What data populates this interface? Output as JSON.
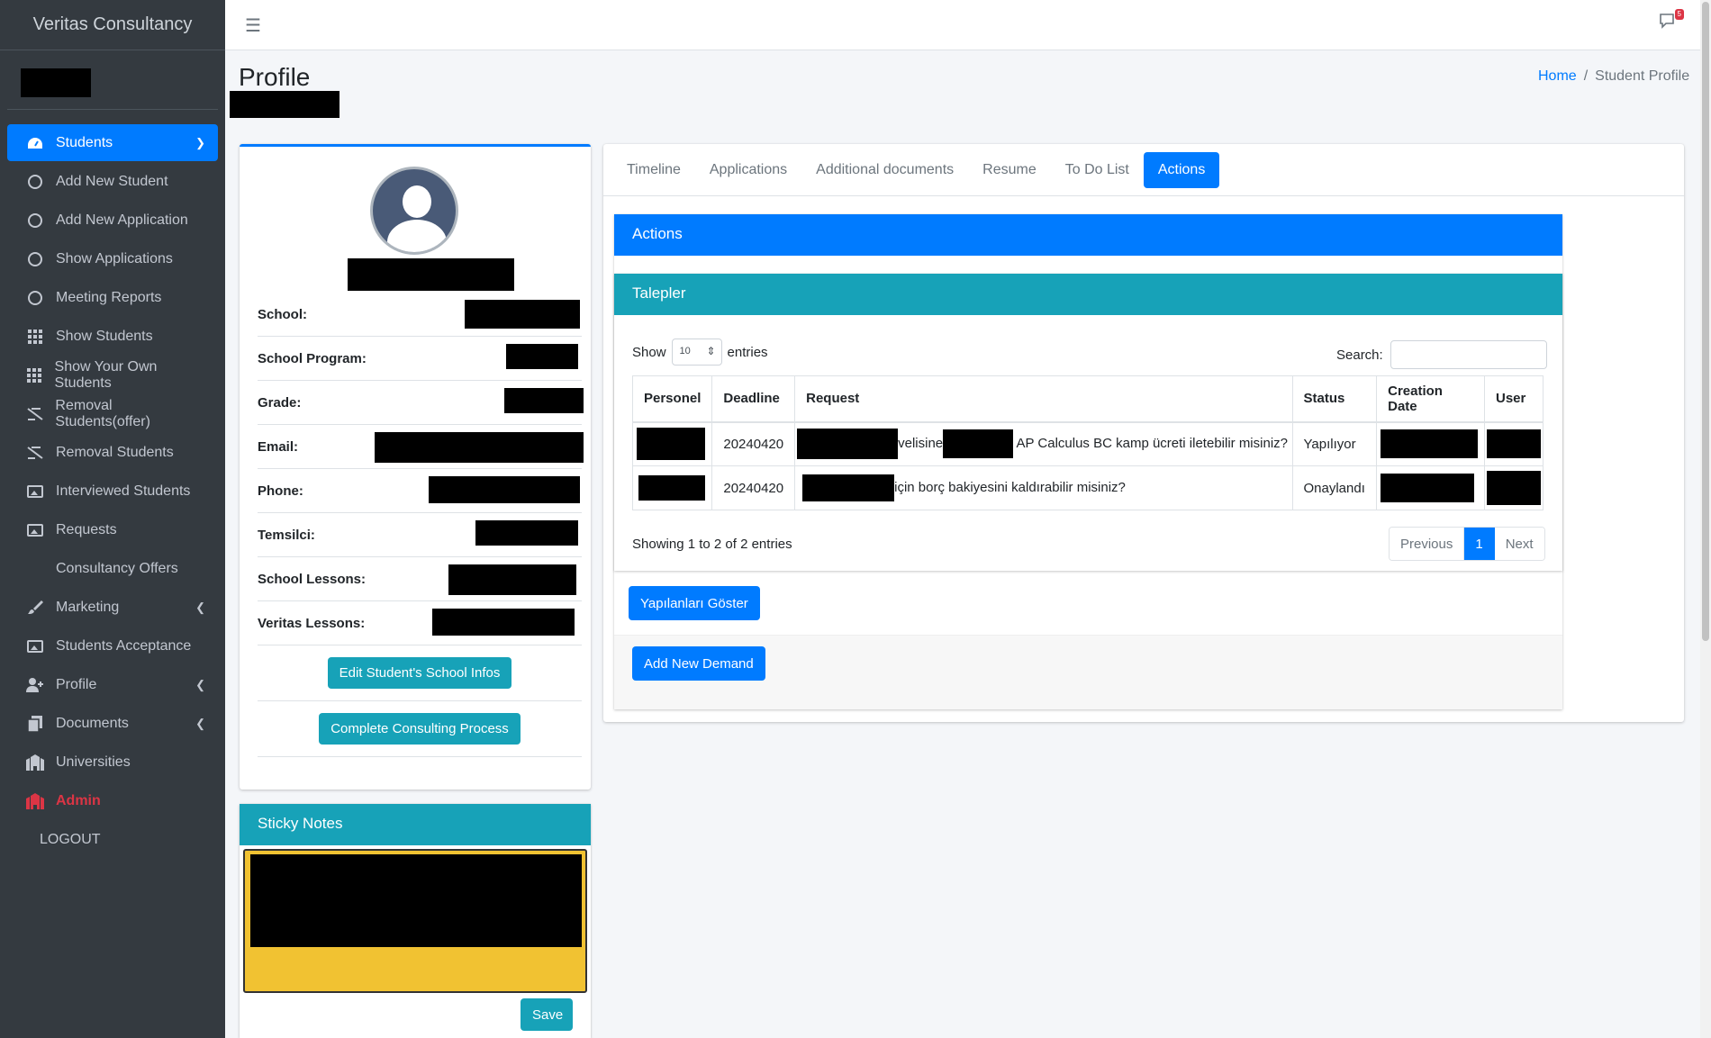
{
  "brand": "Veritas Consultancy",
  "sidebar": {
    "items": [
      {
        "label": "Students",
        "icon": "dashboard-icon",
        "active": true
      },
      {
        "label": "Add New Student",
        "icon": "circle-icon"
      },
      {
        "label": "Add New Application",
        "icon": "circle-icon"
      },
      {
        "label": "Show Applications",
        "icon": "circle-icon"
      },
      {
        "label": "Meeting Reports",
        "icon": "circle-icon"
      },
      {
        "label": "Show Students",
        "icon": "grid-icon"
      },
      {
        "label": "Show Your Own Students",
        "icon": "grid-icon"
      },
      {
        "label": "Removal Students(offer)",
        "icon": "remove-user-icon"
      },
      {
        "label": "Removal Students",
        "icon": "remove-user-icon"
      },
      {
        "label": "Interviewed Students",
        "icon": "image-icon"
      },
      {
        "label": "Requests",
        "icon": "image-icon"
      },
      {
        "label": "Consultancy Offers",
        "icon": ""
      },
      {
        "label": "Marketing",
        "icon": "brush-icon"
      },
      {
        "label": "Students Acceptance",
        "icon": "image-icon"
      },
      {
        "label": "Profile",
        "icon": "user-plus-icon"
      },
      {
        "label": "Documents",
        "icon": "documents-icon"
      },
      {
        "label": "Universities",
        "icon": "university-icon"
      },
      {
        "label": "Admin",
        "icon": "admin-icon"
      },
      {
        "label": "LOGOUT",
        "icon": ""
      }
    ]
  },
  "topbar": {
    "notification_count": "5"
  },
  "page": {
    "title": "Profile",
    "breadcrumb": {
      "home": "Home",
      "current": "Student Profile"
    }
  },
  "profile": {
    "fields": [
      {
        "label": "School:"
      },
      {
        "label": "School Program:"
      },
      {
        "label": "Grade:"
      },
      {
        "label": "Email:"
      },
      {
        "label": "Phone:"
      },
      {
        "label": "Temsilci:"
      },
      {
        "label": "School Lessons:"
      },
      {
        "label": "Veritas Lessons:"
      }
    ],
    "edit_button": "Edit Student's School Infos",
    "complete_button": "Complete Consulting Process"
  },
  "sticky_notes": {
    "title": "Sticky Notes",
    "save_button": "Save"
  },
  "tabs": [
    "Timeline",
    "Applications",
    "Additional documents",
    "Resume",
    "To Do List",
    "Actions"
  ],
  "active_tab": "Actions",
  "actions": {
    "title": "Actions",
    "talepler_title": "Talepler",
    "show_label": "Show",
    "entries_value": "10",
    "entries_label": "entries",
    "search_label": "Search:",
    "columns": [
      "Personel",
      "Deadline",
      "Request",
      "Status",
      "Creation Date",
      "User"
    ],
    "rows": [
      {
        "deadline": "20240420",
        "request_part1": "velisine",
        "request_part2": "AP Calculus BC kamp ücreti iletebilir misiniz?",
        "status": "Yapılıyor"
      },
      {
        "deadline": "20240420",
        "request_part1": "için borç bakiyesini kaldırabilir misiniz?",
        "request_part2": "",
        "status": "Onaylandı"
      }
    ],
    "info": "Showing 1 to 2 of 2 entries",
    "pager": {
      "previous": "Previous",
      "current": "1",
      "next": "Next"
    },
    "show_done_button": "Yapılanları Göster",
    "add_demand_button": "Add New Demand"
  },
  "colors": {
    "primary": "#007bff",
    "info": "#17a2b8",
    "sidebar": "#343a40",
    "sticky": "#f1c232",
    "danger": "#dc3545"
  }
}
